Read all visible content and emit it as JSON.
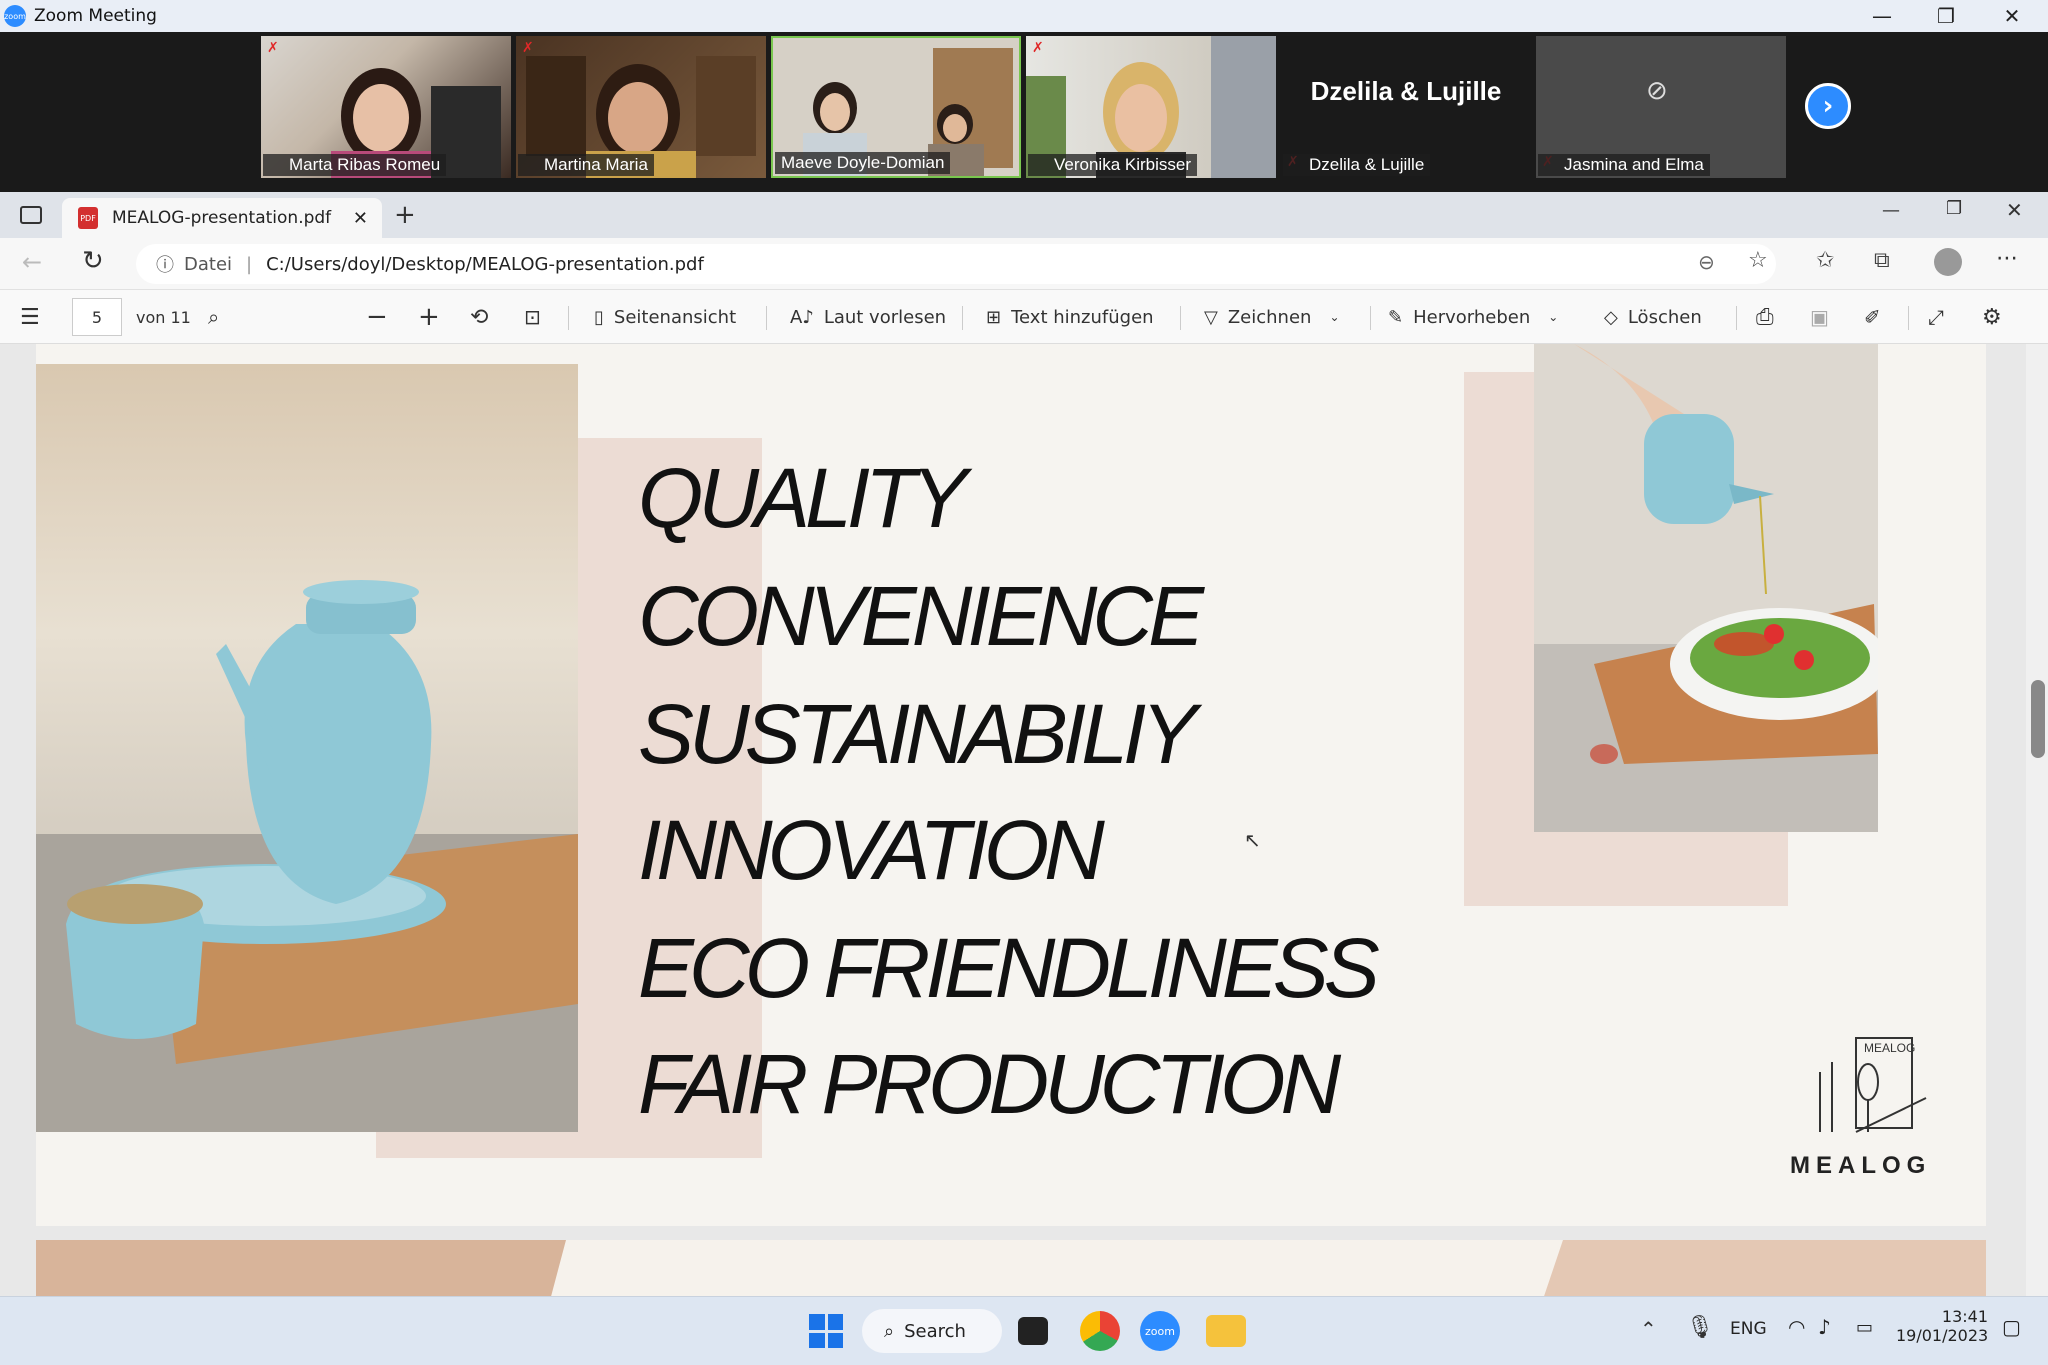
{
  "zoom": {
    "window_title": "Zoom Meeting",
    "participants": [
      {
        "name": "Marta Ribas Romeu",
        "muted": true
      },
      {
        "name": "Martina Maria",
        "muted": true
      },
      {
        "name": "Maeve Doyle-Domian",
        "muted": false,
        "active_speaker": true
      },
      {
        "name": "Veronika Kirbisser",
        "muted": true
      },
      {
        "name": "Dzelila & Lujille",
        "muted": true,
        "video_off": true,
        "display_card": "Dzelila & Lujille"
      },
      {
        "name": "Jasmina and Elma",
        "muted": true,
        "video_off": true
      }
    ],
    "next_icon": "chevron-right-icon"
  },
  "browser": {
    "tab_title": "MEALOG-presentation.pdf",
    "address_label": "Datei",
    "address_url": "C:/Users/doyl/Desktop/MEALOG-presentation.pdf",
    "pdf_toolbar": {
      "page_number": "5",
      "page_total": "von 11",
      "page_view": "Seitenansicht",
      "read_aloud": "Laut vorlesen",
      "add_text": "Text hinzufügen",
      "draw": "Zeichnen",
      "highlight": "Hervorheben",
      "erase": "Löschen"
    }
  },
  "slide": {
    "values": [
      "QUALITY",
      "CONVENIENCE",
      "SUSTAINABILIY",
      "INNOVATION",
      "ECO FRIENDLINESS",
      "FAIR PRODUCTION"
    ],
    "logo_text": "MEALOG",
    "logo_small": "MEALOG"
  },
  "taskbar": {
    "search_label": "Search",
    "language": "ENG",
    "time": "13:41",
    "date": "19/01/2023"
  },
  "colors": {
    "zoom_blue": "#2d8cff",
    "slide_bg": "#f6f4f0",
    "accent_pink": "#ecdcd4",
    "teal_product": "#8fc8d6"
  }
}
